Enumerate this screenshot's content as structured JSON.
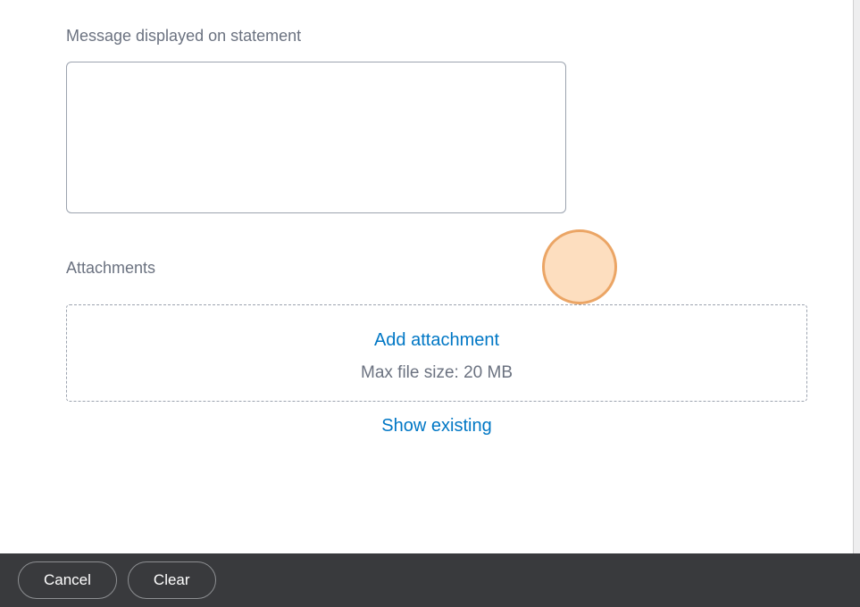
{
  "form": {
    "message_label": "Message displayed on statement",
    "message_value": ""
  },
  "attachments": {
    "label": "Attachments",
    "add_label": "Add attachment",
    "max_size_text": "Max file size: 20 MB",
    "show_existing_label": "Show existing"
  },
  "footer": {
    "cancel_label": "Cancel",
    "clear_label": "Clear"
  }
}
